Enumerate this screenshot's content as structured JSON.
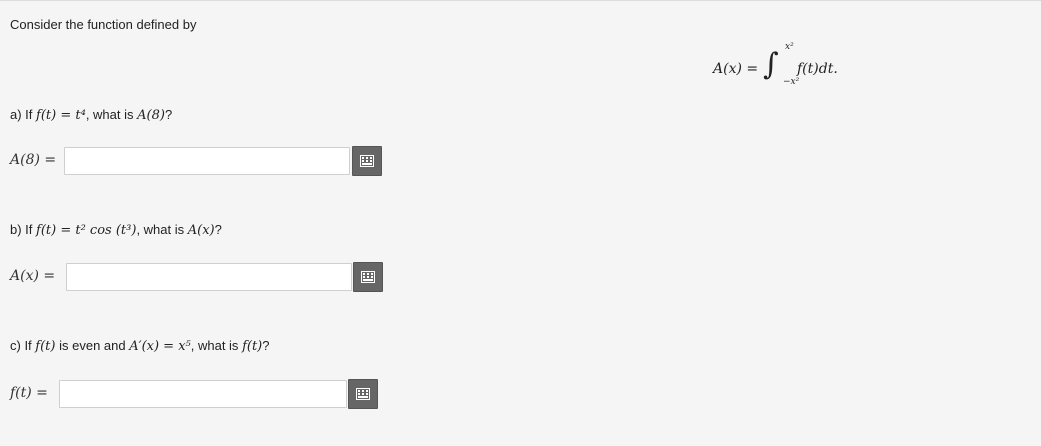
{
  "intro": "Consider the function defined by",
  "definition": {
    "lhs": "A(x) =",
    "integral_sign": "∫",
    "upper_limit": "x²",
    "lower_limit": "−x²",
    "integrand": "f(t)dt."
  },
  "parts": [
    {
      "prefix": "a) If",
      "condition": "f(t) = t⁴",
      "question": ", what is",
      "target": "A(8)",
      "end": "?",
      "answer_label": "A(8) =",
      "answer_value": ""
    },
    {
      "prefix": "b) If",
      "condition": "f(t) = t² cos (t³)",
      "question": ", what is",
      "target": "A(x)",
      "end": "?",
      "answer_label": "A(x) =",
      "answer_value": ""
    },
    {
      "prefix": "c) If",
      "condition": "f(t)",
      "question": "is even and",
      "extra": "A′(x) = x⁵",
      "question2": ", what is",
      "target": "f(t)",
      "end": "?",
      "answer_label": "f(t) =",
      "answer_value": ""
    }
  ],
  "icons": {
    "keypad": "keypad-icon"
  },
  "colors": {
    "background": "#f5f5f5",
    "button": "#666666",
    "input_border": "#cfcfcf"
  }
}
